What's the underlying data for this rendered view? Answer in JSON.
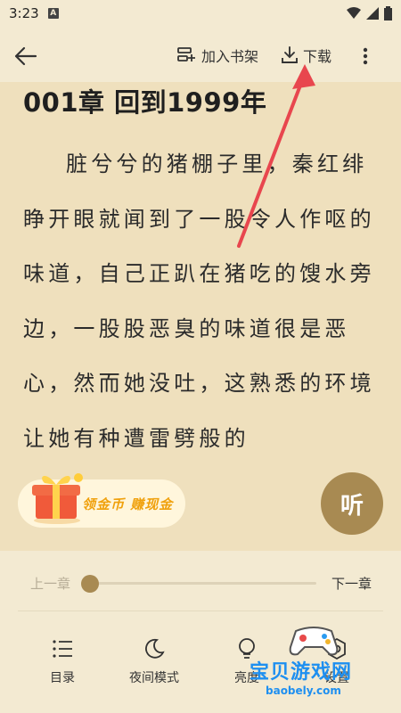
{
  "status_bar": {
    "time": "3:23",
    "notification_badge": "A"
  },
  "toolbar": {
    "add_shelf_label": "加入书架",
    "download_label": "下载"
  },
  "chapter": {
    "title": "001章 回到1999年",
    "text": "脏兮兮的猪棚子里，秦红绯睁开眼就闻到了一股令人作呕的味道，自己正趴在猪吃的馊水旁边，一股股恶臭的味道很是恶心，然而她没吐，这熟悉的环境让她有种遭雷劈般的"
  },
  "promo": {
    "text": "领金币 赚现金"
  },
  "listen": {
    "label": "听"
  },
  "progress": {
    "prev_label": "上一章",
    "next_label": "下一章",
    "value_fraction": 0.0
  },
  "bottom_nav": {
    "items": [
      {
        "label": "目录",
        "icon": "list-icon"
      },
      {
        "label": "夜间模式",
        "icon": "moon-icon"
      },
      {
        "label": "亮度",
        "icon": "bulb-icon"
      },
      {
        "label": "设置",
        "icon": "settings-icon"
      }
    ]
  },
  "watermark": {
    "text": "宝贝游戏网",
    "url": "baobely.com"
  },
  "colors": {
    "accent": "#a88a52",
    "reading_bg": "#efe0bd",
    "panel_bg": "#f3ead2",
    "annotation_arrow": "#e8464e",
    "watermark_blue": "#1e8ff0",
    "promo_orange": "#f0a10d"
  }
}
